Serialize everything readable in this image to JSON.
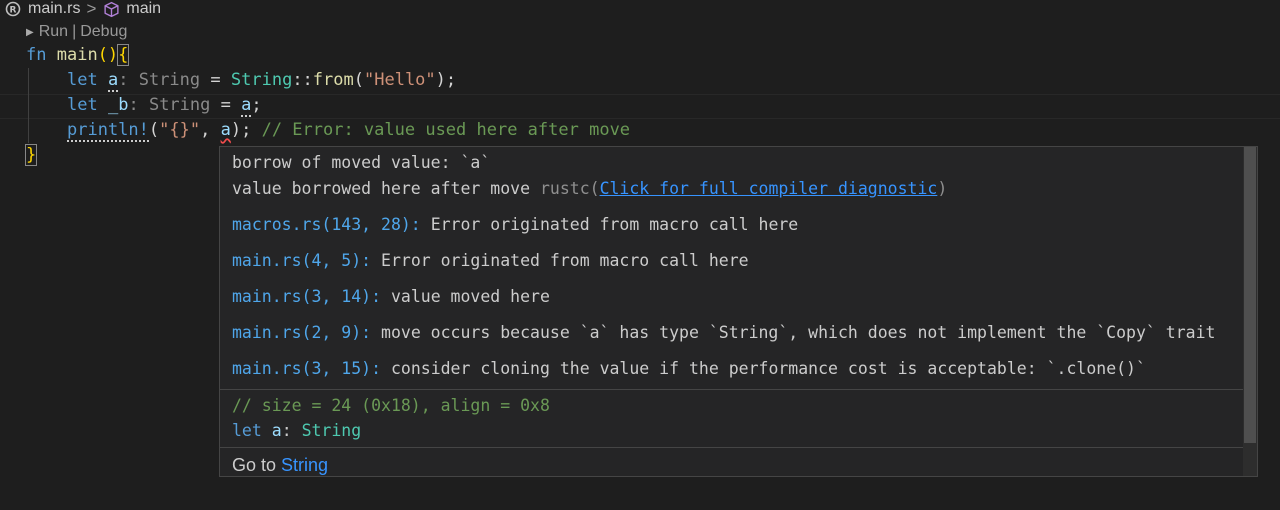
{
  "breadcrumb": {
    "file": "main.rs",
    "symbol": "main",
    "separator": ">"
  },
  "codelens": {
    "run": "Run",
    "divider": "|",
    "debug": "Debug"
  },
  "code": {
    "line1": {
      "kw": "fn",
      "name": "main",
      "paren": "()",
      "brace": "{"
    },
    "line2": {
      "kw": "let",
      "var": "a",
      "colon": ":",
      "hint_type": "String",
      "eq": "=",
      "type": "String",
      "path": "::",
      "fn": "from",
      "open": "(",
      "str": "\"Hello\"",
      "close": ");"
    },
    "line3": {
      "kw": "let",
      "var": "_b",
      "colon": ":",
      "hint_type": "String",
      "eq": "=",
      "val": "a",
      "semi": ";"
    },
    "line4": {
      "macro": "println!",
      "open": "(",
      "str": "\"{}\"",
      "comma": ",",
      "arg": "a",
      "close": ");",
      "comment": "// Error: value used here after move"
    },
    "line5": {
      "brace": "}"
    }
  },
  "hover": {
    "error_title": "borrow of moved value: `a`",
    "error_detail": "value borrowed here after move",
    "source": "rustc",
    "full_diag_link": "Click for full compiler diagnostic",
    "related": [
      {
        "location": "macros.rs(143, 28):",
        "message": "Error originated from macro call here"
      },
      {
        "location": "main.rs(4, 5):",
        "message": "Error originated from macro call here"
      },
      {
        "location": "main.rs(3, 14):",
        "message": "value moved here"
      },
      {
        "location": "main.rs(2, 9):",
        "message": "move occurs because `a` has type `String`, which does not implement the `Copy` trait"
      },
      {
        "location": "main.rs(3, 15):",
        "message": "consider cloning the value if the performance cost is acceptable: `.clone()`"
      }
    ],
    "size_comment": "// size = 24 (0x18), align = 0x8",
    "decl_kw": "let",
    "decl_var": "a",
    "decl_colon": ":",
    "decl_type": "String",
    "goto_label": "Go to",
    "goto_target": "String"
  },
  "colors": {
    "background": "#1e1e1e",
    "keyword": "#569cd6",
    "function": "#dcdcaa",
    "type": "#4ec9b0",
    "string": "#ce9178",
    "comment": "#6a9955",
    "link": "#3794ff",
    "error": "#f14c4c"
  }
}
